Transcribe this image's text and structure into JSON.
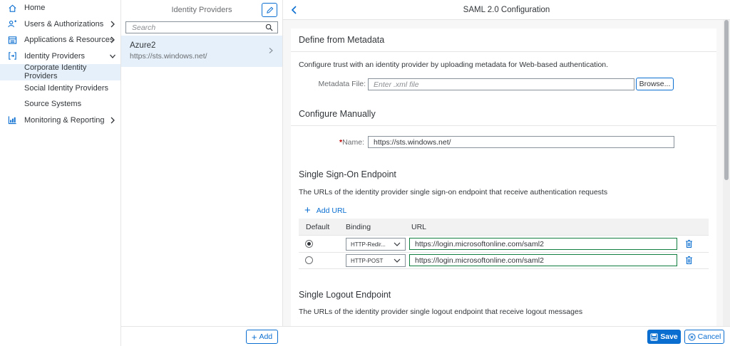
{
  "nav": {
    "items": [
      {
        "label": "Home",
        "icon": "home-icon"
      },
      {
        "label": "Users & Authorizations",
        "icon": "users-icon"
      },
      {
        "label": "Applications & Resources",
        "icon": "applications-icon"
      },
      {
        "label": "Identity Providers",
        "icon": "identity-providers-icon"
      },
      {
        "label": "Monitoring & Reporting",
        "icon": "monitoring-icon"
      }
    ],
    "sub_items": [
      {
        "label": "Corporate Identity Providers"
      },
      {
        "label": "Social Identity Providers"
      },
      {
        "label": "Source Systems"
      }
    ]
  },
  "idp_list": {
    "title": "Identity Providers",
    "search_placeholder": "Search",
    "items": [
      {
        "name": "Azure2",
        "url": "https://sts.windows.net/"
      }
    ],
    "add_label": "Add"
  },
  "detail": {
    "title": "SAML 2.0 Configuration",
    "metadata": {
      "section_title": "Define from Metadata",
      "description": "Configure trust with an identity provider by uploading metadata for Web-based authentication.",
      "file_label": "Metadata File:",
      "file_placeholder": "Enter .xml file",
      "browse_label": "Browse..."
    },
    "manual": {
      "section_title": "Configure Manually",
      "required_mark": "*",
      "name_label": "Name:",
      "name_value": "https://sts.windows.net/"
    },
    "sso": {
      "section_title": "Single Sign-On Endpoint",
      "description": "The URLs of the identity provider single sign-on endpoint that receive authentication requests",
      "add_url_label": "Add URL",
      "columns": {
        "default": "Default",
        "binding": "Binding",
        "url": "URL"
      },
      "rows": [
        {
          "default": true,
          "binding": "HTTP-Redir...",
          "url": "https://login.microsoftonline.com/saml2"
        },
        {
          "default": false,
          "binding": "HTTP-POST",
          "url": "https://login.microsoftonline.com/saml2"
        }
      ]
    },
    "slo": {
      "section_title": "Single Logout Endpoint",
      "description": "The URLs of the identity provider single logout endpoint that receive logout messages"
    },
    "save_label": "Save",
    "cancel_label": "Cancel"
  },
  "colors": {
    "accent": "#0a6ed1",
    "selected_bg": "#e5f0fa",
    "valid_border": "#107e3e",
    "required": "#bb0000"
  }
}
